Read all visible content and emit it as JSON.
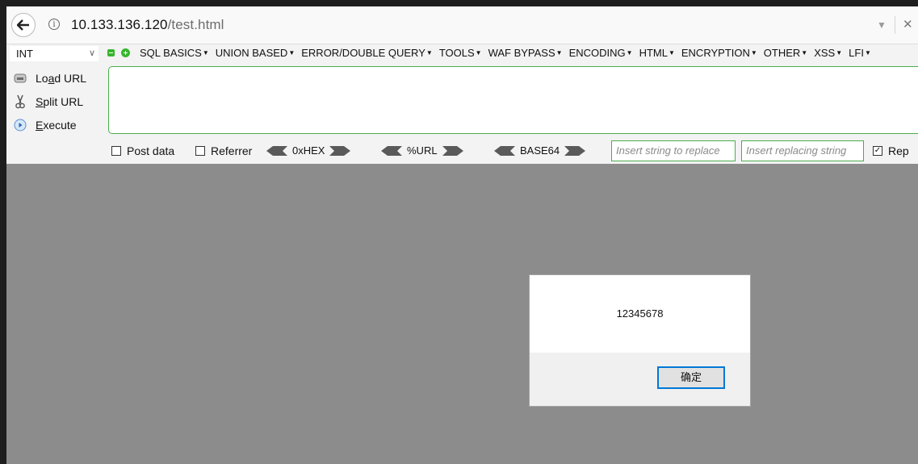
{
  "browser": {
    "url_host": "10.133.136.120",
    "url_path": "/test.html",
    "dropdown_glyph": "▼",
    "close_glyph": "✕"
  },
  "hackbar": {
    "type_select": "INT",
    "menus": [
      {
        "label": "SQL BASICS"
      },
      {
        "label": "UNION BASED"
      },
      {
        "label": "ERROR/DOUBLE QUERY"
      },
      {
        "label": "TOOLS"
      },
      {
        "label": "WAF BYPASS"
      },
      {
        "label": "ENCODING"
      },
      {
        "label": "HTML"
      },
      {
        "label": "ENCRYPTION"
      },
      {
        "label": "OTHER"
      },
      {
        "label": "XSS"
      },
      {
        "label": "LFI"
      }
    ],
    "actions": {
      "load": {
        "pre": "Lo",
        "key": "a",
        "post": "d URL"
      },
      "split": {
        "pre": "",
        "key": "S",
        "post": "plit URL"
      },
      "execute": {
        "pre": "",
        "key": "E",
        "post": "xecute"
      }
    },
    "post_data_label": "Post data",
    "referrer_label": "Referrer",
    "hex_label": "0xHEX",
    "url_label": "%URL",
    "base64_label": "BASE64",
    "replace_placeholder": "Insert string to replace",
    "replacing_placeholder": "Insert replacing string",
    "replace_all_label": "Rep"
  },
  "dialog": {
    "message": "12345678",
    "ok_label": "确定"
  },
  "colors": {
    "accent_green": "#4cae4c",
    "page_gray": "#8c8c8c",
    "button_focus": "#0078d7"
  }
}
